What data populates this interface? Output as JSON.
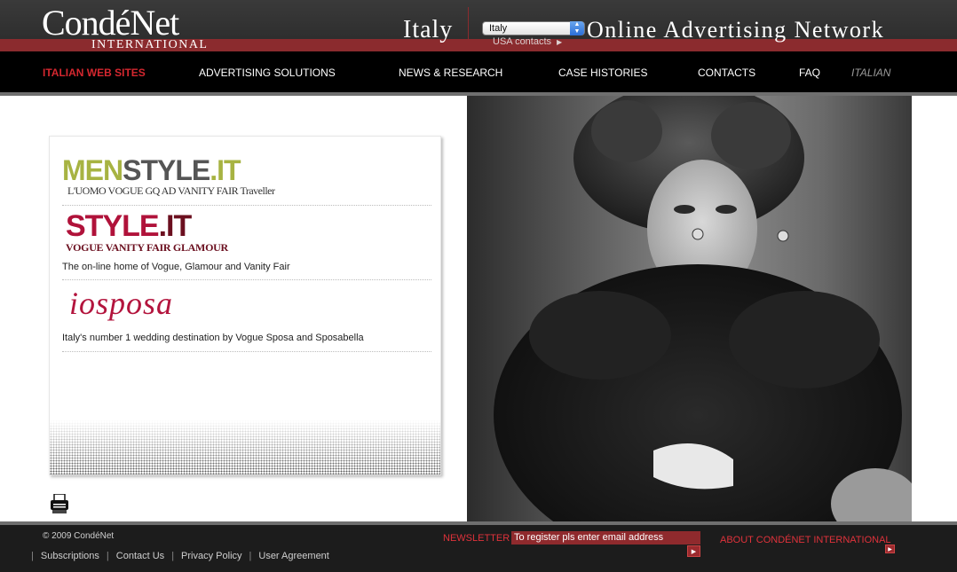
{
  "header": {
    "logo_main": "CondéNet",
    "logo_sub": "INTERNATIONAL",
    "region": "Italy",
    "country_select": {
      "selected": "Italy"
    },
    "usa_contacts": "USA contacts",
    "tagline": "Online Advertising Network"
  },
  "nav": {
    "items": [
      {
        "label": "ITALIAN WEB SITES"
      },
      {
        "label": "ADVERTISING SOLUTIONS"
      },
      {
        "label": "NEWS & RESEARCH"
      },
      {
        "label": "CASE HISTORIES"
      },
      {
        "label": "CONTACTS"
      },
      {
        "label": "FAQ"
      },
      {
        "label": "ITALIAN"
      }
    ]
  },
  "sites": [
    {
      "logo_parts": [
        "MEN",
        "STYLE",
        ".IT"
      ],
      "brands": "L'UOMO VOGUE  GQ  AD  VANITY FAIR  Traveller",
      "description": ""
    },
    {
      "logo_parts": [
        "STYLE",
        ".IT"
      ],
      "brands": "VOGUE VANITY FAIR GLAMOUR",
      "description": "The on-line home of Vogue, Glamour and Vanity Fair"
    },
    {
      "logo_parts": [
        "iosposa"
      ],
      "brands": "",
      "description": "Italy's number 1 wedding destination by Vogue Sposa and Sposabella"
    }
  ],
  "footer": {
    "copyright": "© 2009 CondéNet",
    "links": [
      "Subscriptions",
      "Contact Us",
      "Privacy Policy",
      "User Agreement"
    ],
    "newsletter_label": "NEWSLETTER",
    "newsletter_placeholder": "To register pls enter email address",
    "about_link": "ABOUT CONDÉNET INTERNATIONAL"
  },
  "colors": {
    "accent_red": "#d4272f",
    "header_band": "#8b2b2e",
    "menstyle_green": "#a7b342",
    "style_crimson": "#b0123a"
  }
}
